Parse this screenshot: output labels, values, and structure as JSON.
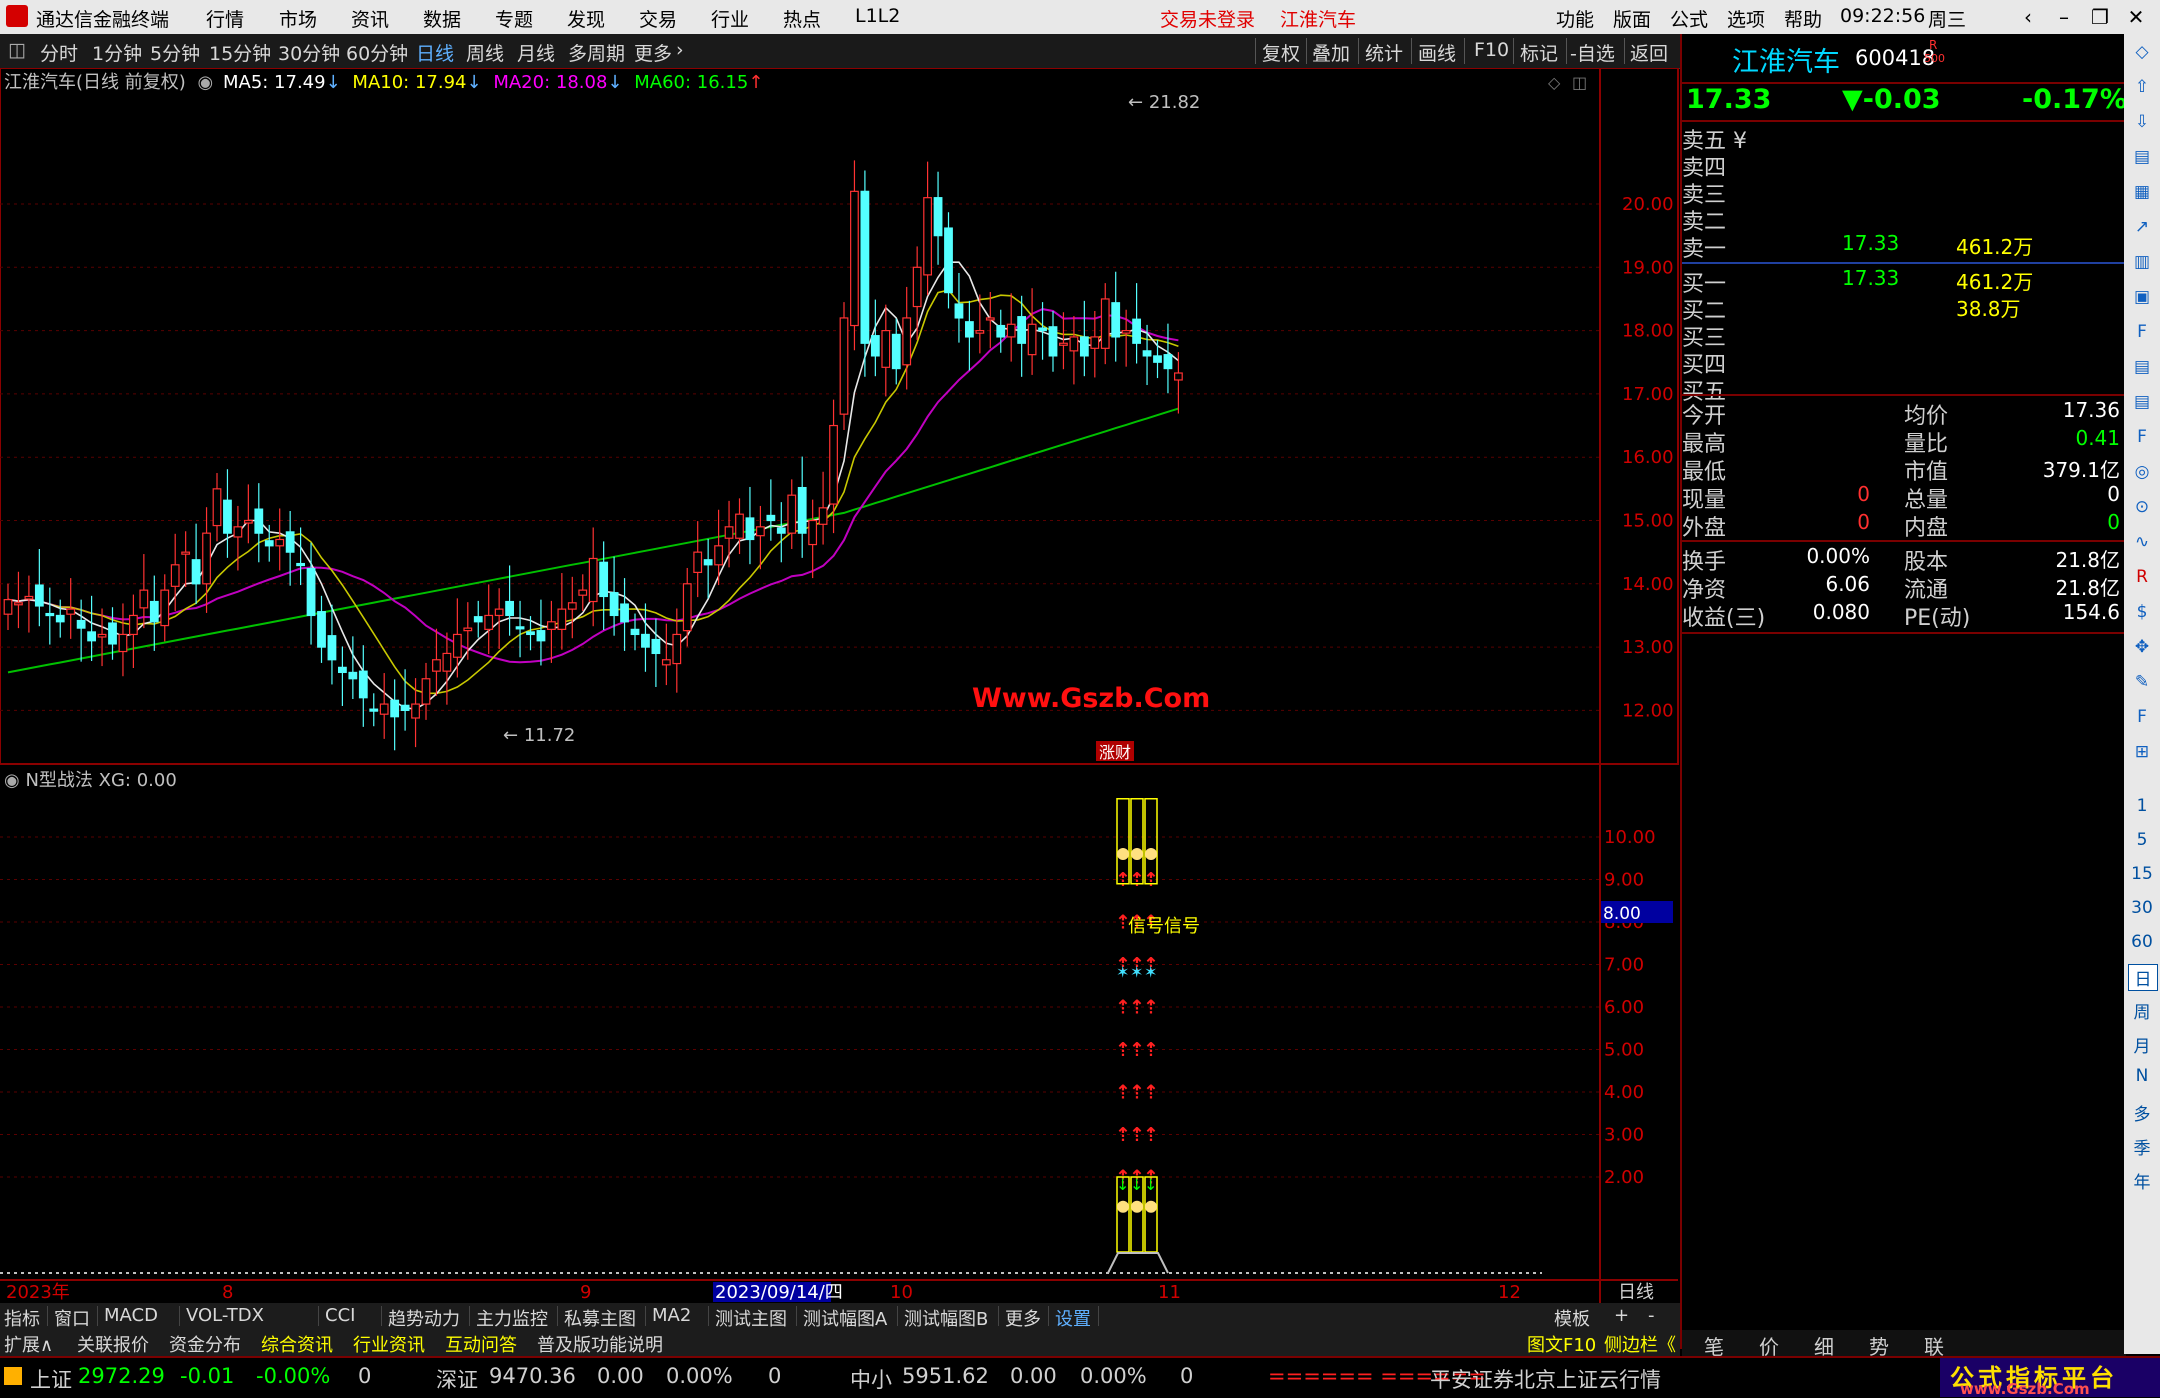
{
  "app": {
    "title": "通达信金融终端",
    "menu": [
      "行情",
      "市场",
      "资讯",
      "数据",
      "专题",
      "发现",
      "交易",
      "行业",
      "热点",
      "L1L2"
    ],
    "login_status": "交易未登录",
    "current_stock": "江淮汽车",
    "right_menu": [
      "功能",
      "版面",
      "公式",
      "选项",
      "帮助"
    ],
    "time": "09:22:56",
    "weekday": "周三"
  },
  "periods": {
    "items": [
      "分时",
      "1分钟",
      "5分钟",
      "15分钟",
      "30分钟",
      "60分钟",
      "日线",
      "周线",
      "月线",
      "多周期",
      "更多"
    ],
    "active": "日线",
    "tools": [
      "复权",
      "叠加",
      "统计",
      "画线",
      "F10",
      "标记",
      "-自选",
      "返回"
    ]
  },
  "main_chart": {
    "header": "江淮汽车(日线 前复权)",
    "ma": [
      {
        "label": "MA5: 17.49",
        "color": "#ffffff"
      },
      {
        "label": "MA10: 17.94",
        "color": "#ffff00"
      },
      {
        "label": "MA20: 18.08",
        "color": "#ff00ff"
      },
      {
        "label": "MA60: 16.15",
        "color": "#00ff00"
      }
    ],
    "high_label": "21.82",
    "low_label": "11.72",
    "watermark": "Www.Gszb.Com",
    "marker": "涨财",
    "y_ticks": [
      "20.00",
      "19.00",
      "18.00",
      "17.00",
      "16.00",
      "15.00",
      "14.00",
      "13.00",
      "12.00"
    ]
  },
  "sub_chart": {
    "header": "N型战法 XG: 0.00",
    "y_ticks": [
      "10.00",
      "9.00",
      "8.00",
      "7.00",
      "6.00",
      "5.00",
      "4.00",
      "3.00",
      "2.00"
    ],
    "cursor_value": "8.00",
    "signal_text": "信号信号"
  },
  "time_axis": {
    "labels": [
      "2023年",
      "8",
      "9",
      "2023/09/14/四",
      "10",
      "11",
      "12"
    ],
    "period": "日线"
  },
  "indicator_tabs": [
    "指标",
    "窗口",
    "MACD",
    "VOL-TDX",
    "CCI",
    "趋势动力",
    "主力监控",
    "私募主图",
    "MA2",
    "测试主图",
    "测试幅图A",
    "测试幅图B",
    "更多",
    "设置"
  ],
  "indicator_right": [
    "模板",
    "+",
    "-"
  ],
  "ext_tabs": [
    "扩展∧",
    "关联报价",
    "资金分布",
    "综合资讯",
    "行业资讯",
    "互动问答",
    "普及版功能说明"
  ],
  "ext_right": [
    "图文F10",
    "侧边栏《"
  ],
  "quote": {
    "name": "江淮汽车",
    "code": "600418",
    "badge_r": "R",
    "badge_500": "500",
    "price": "17.33",
    "change": "▼-0.03",
    "change_pct": "-0.17%",
    "asks": [
      {
        "label": "卖五 ¥",
        "price": "",
        "vol": ""
      },
      {
        "label": "卖四",
        "price": "",
        "vol": ""
      },
      {
        "label": "卖三",
        "price": "",
        "vol": ""
      },
      {
        "label": "卖二",
        "price": "",
        "vol": ""
      },
      {
        "label": "卖一",
        "price": "17.33",
        "vol": "461.2万"
      }
    ],
    "bids": [
      {
        "label": "买一",
        "price": "17.33",
        "vol": "461.2万"
      },
      {
        "label": "买二",
        "price": "",
        "vol": "38.8万"
      },
      {
        "label": "买三",
        "price": "",
        "vol": ""
      },
      {
        "label": "买四",
        "price": "",
        "vol": ""
      },
      {
        "label": "买五",
        "price": "",
        "vol": ""
      }
    ],
    "stats1": [
      {
        "l1": "今开",
        "v1": "",
        "l2": "均价",
        "v2": "17.36",
        "c2": "#ffffff"
      },
      {
        "l1": "最高",
        "v1": "",
        "l2": "量比",
        "v2": "0.41",
        "c2": "#00ff00"
      },
      {
        "l1": "最低",
        "v1": "",
        "l2": "市值",
        "v2": "379.1亿",
        "c2": "#ffffff"
      },
      {
        "l1": "现量",
        "v1": "0",
        "l2": "总量",
        "v2": "0",
        "c2": "#ffffff"
      },
      {
        "l1": "外盘",
        "v1": "0",
        "l2": "内盘",
        "v2": "0",
        "c2": "#00ff00"
      }
    ],
    "stats2": [
      {
        "l1": "换手",
        "v1": "0.00%",
        "l2": "股本",
        "v2": "21.8亿"
      },
      {
        "l1": "净资",
        "v1": "6.06",
        "l2": "流通",
        "v2": "21.8亿"
      },
      {
        "l1": "收益(三)",
        "v1": "0.080",
        "l2": "PE(动)",
        "v2": "154.6"
      }
    ],
    "bottom_tabs": [
      "笔",
      "价",
      "细",
      "势",
      "联"
    ]
  },
  "side_tools": [
    "1",
    "5",
    "15",
    "30",
    "60",
    "日",
    "周",
    "月",
    "N",
    "多",
    "季",
    "年"
  ],
  "status": {
    "sh_name": "上证",
    "sh_val": "2972.29",
    "sh_chg": "-0.01",
    "sh_pct": "-0.00%",
    "sh_vol": "0",
    "sz_name": "深证",
    "sz_val": "9470.36",
    "sz_chg": "0.00",
    "sz_pct": "0.00%",
    "sz_vol": "0",
    "zx_name": "中小",
    "zx_val": "5951.62",
    "zx_chg": "0.00",
    "zx_pct": "0.00%",
    "zx_vol": "0",
    "bars": "====== ======",
    "server": "平安证券北京上证云行情",
    "brand": "公式指标平台",
    "brand_url": "www.Gszb.Com"
  }
}
